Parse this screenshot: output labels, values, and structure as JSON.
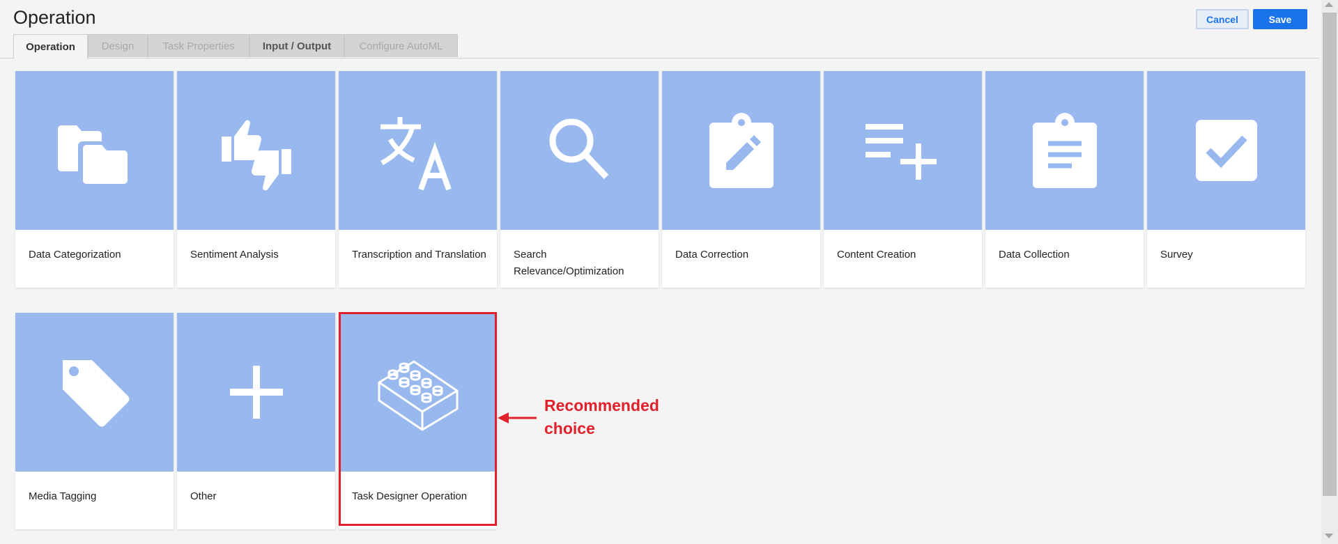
{
  "header": {
    "title": "Operation",
    "cancel_label": "Cancel",
    "save_label": "Save"
  },
  "tabs": [
    {
      "label": "Operation",
      "state": "active"
    },
    {
      "label": "Design",
      "state": "disabled"
    },
    {
      "label": "Task Properties",
      "state": "disabled"
    },
    {
      "label": "Input / Output",
      "state": "enabled"
    },
    {
      "label": "Configure AutoML",
      "state": "disabled"
    }
  ],
  "cards": [
    {
      "label": "Data Categorization",
      "icon": "folders-icon"
    },
    {
      "label": "Sentiment Analysis",
      "icon": "thumbs-up-down-icon"
    },
    {
      "label": "Transcription and Translation",
      "icon": "translate-icon"
    },
    {
      "label": "Search Relevance/Optimization",
      "icon": "search-icon"
    },
    {
      "label": "Data Correction",
      "icon": "clipboard-edit-icon"
    },
    {
      "label": "Content Creation",
      "icon": "playlist-add-icon"
    },
    {
      "label": "Data Collection",
      "icon": "clipboard-list-icon"
    },
    {
      "label": "Survey",
      "icon": "checkbox-icon"
    },
    {
      "label": "Media Tagging",
      "icon": "tag-icon"
    },
    {
      "label": "Other",
      "icon": "plus-icon"
    },
    {
      "label": "Task Designer Operation",
      "icon": "lego-brick-icon"
    }
  ],
  "annotation": {
    "text": "Recommended choice",
    "color": "#e0202a"
  },
  "colors": {
    "card_image_bg": "#99b8ee",
    "primary": "#1a73e8"
  }
}
